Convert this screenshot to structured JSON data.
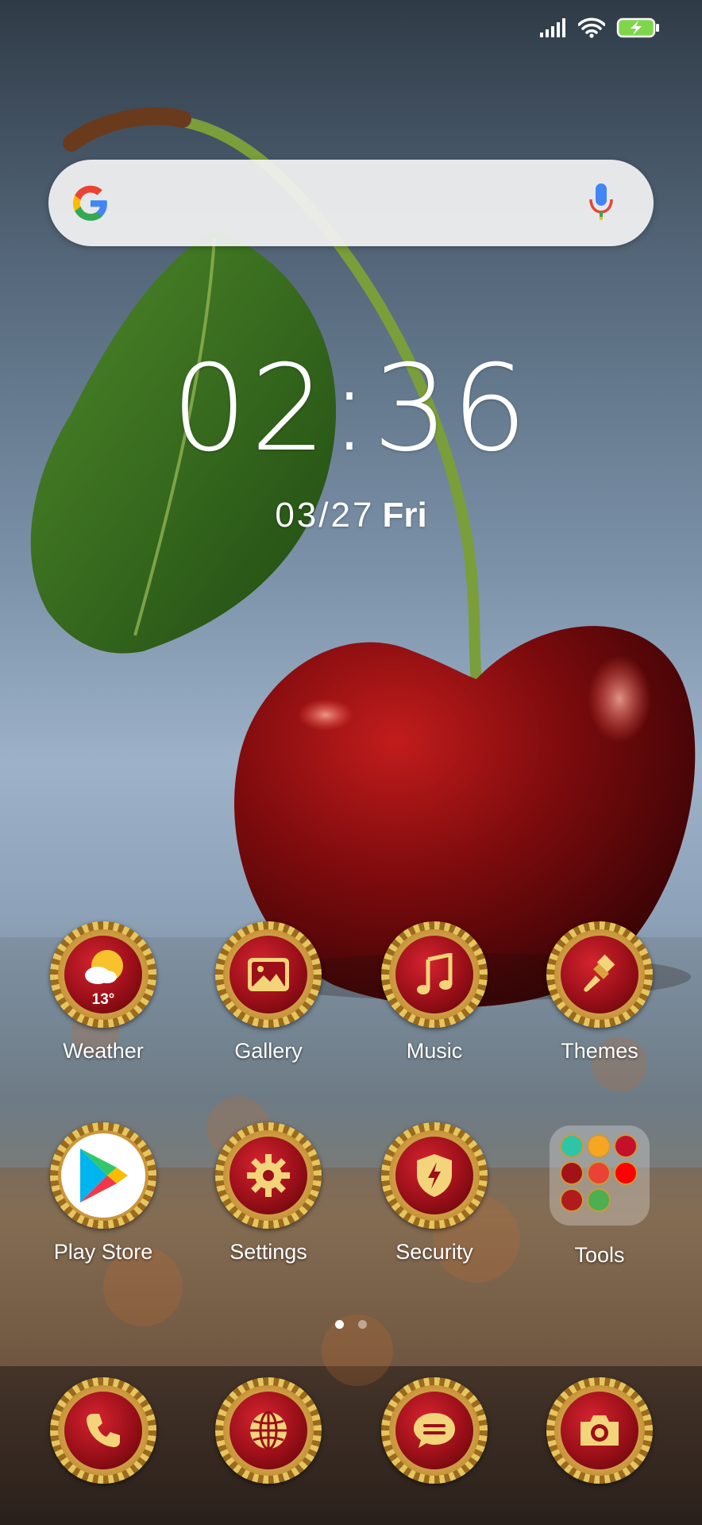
{
  "status_bar": {
    "signal_icon": "cellular-signal-icon",
    "wifi_icon": "wifi-icon",
    "battery_icon": "battery-charging-icon"
  },
  "search_bar": {
    "logo_icon": "google-g-icon",
    "mic_icon": "microphone-icon"
  },
  "clock": {
    "time": "02:36",
    "date": "03/27",
    "day": "Fri"
  },
  "apps_row1": [
    {
      "label": "Weather",
      "icon": "weather-sun-cloud-icon",
      "temp": "13°"
    },
    {
      "label": "Gallery",
      "icon": "gallery-picture-icon"
    },
    {
      "label": "Music",
      "icon": "music-note-icon"
    },
    {
      "label": "Themes",
      "icon": "paintbrush-icon"
    }
  ],
  "apps_row2": [
    {
      "label": "Play Store",
      "icon": "play-store-icon"
    },
    {
      "label": "Settings",
      "icon": "gear-icon"
    },
    {
      "label": "Security",
      "icon": "shield-bolt-icon"
    },
    {
      "label": "Tools",
      "icon": "folder-icon"
    }
  ],
  "page_indicator": {
    "pages": 2,
    "active": 0
  },
  "dock": [
    {
      "icon": "phone-icon"
    },
    {
      "icon": "globe-browser-icon"
    },
    {
      "icon": "message-bubble-icon"
    },
    {
      "icon": "camera-icon"
    }
  ],
  "colors": {
    "frame_gold": "#e6c55f",
    "core_red": "#9a0f18",
    "search_bg": "#f2f2f2"
  }
}
